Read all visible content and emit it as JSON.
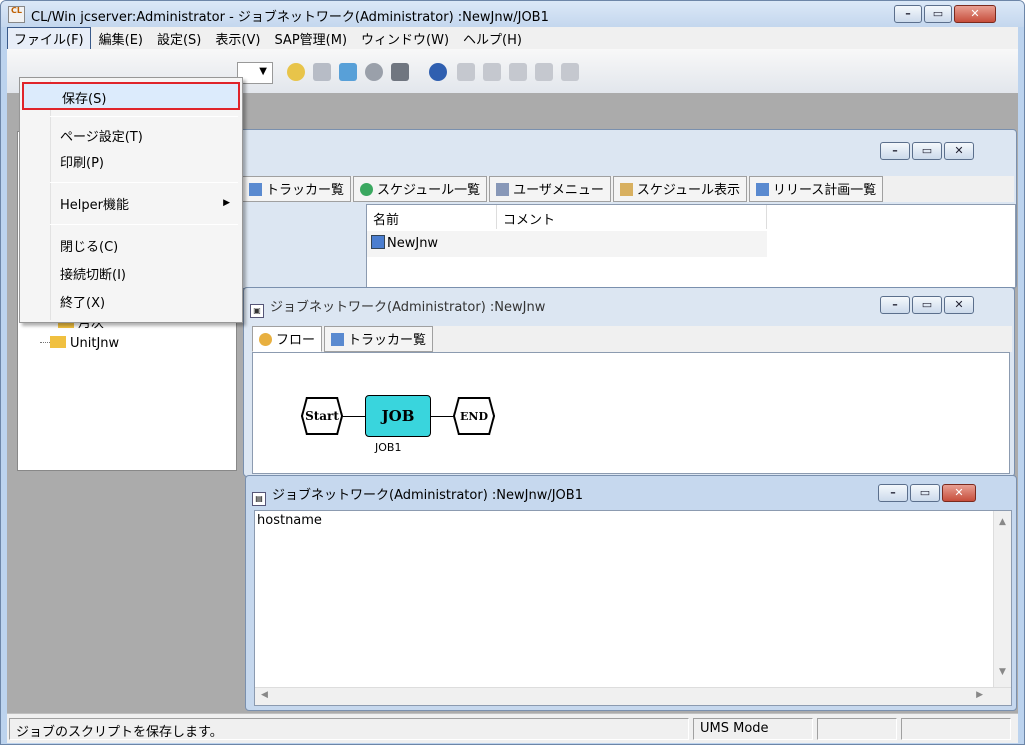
{
  "window": {
    "title": "CL/Win jcserver:Administrator - ジョブネットワーク(Administrator) :NewJnw/JOB1",
    "app_icon": "CL"
  },
  "menubar": [
    "ファイル(F)",
    "編集(E)",
    "設定(S)",
    "表示(V)",
    "SAP管理(M)",
    "ウィンドウ(W)",
    "ヘルプ(H)"
  ],
  "file_menu": {
    "items": [
      "保存(S)",
      "ページ設定(T)",
      "印刷(P)",
      "Helper機能",
      "閉じる(C)",
      "接続切断(I)",
      "終了(X)"
    ],
    "highlight_color": "#e0242a"
  },
  "tree": {
    "items": [
      "月次",
      "UnitJnw"
    ]
  },
  "manager_window": {
    "tabs": [
      "トラッカー覧",
      "スケジュール一覧",
      "ユーザメニュー",
      "スケジュール表示",
      "リリース計画一覧"
    ],
    "columns": [
      "名前",
      "コメント"
    ],
    "rows": [
      {
        "name": "NewJnw"
      }
    ]
  },
  "jnw_window": {
    "title": "ジョブネットワーク(Administrator) :NewJnw",
    "tabs": [
      "フロー",
      "トラッカー覧"
    ],
    "flow": {
      "start": "Start",
      "job": "JOB",
      "job_label": "JOB1",
      "end": "END"
    }
  },
  "job_window": {
    "title": "ジョブネットワーク(Administrator) :NewJnw/JOB1",
    "script": "hostname"
  },
  "statusbar": {
    "message": "ジョブのスクリプトを保存します。",
    "mode": "UMS Mode"
  },
  "colors": {
    "job_fill": "#39d5dd",
    "client_bg": "#ababab"
  }
}
